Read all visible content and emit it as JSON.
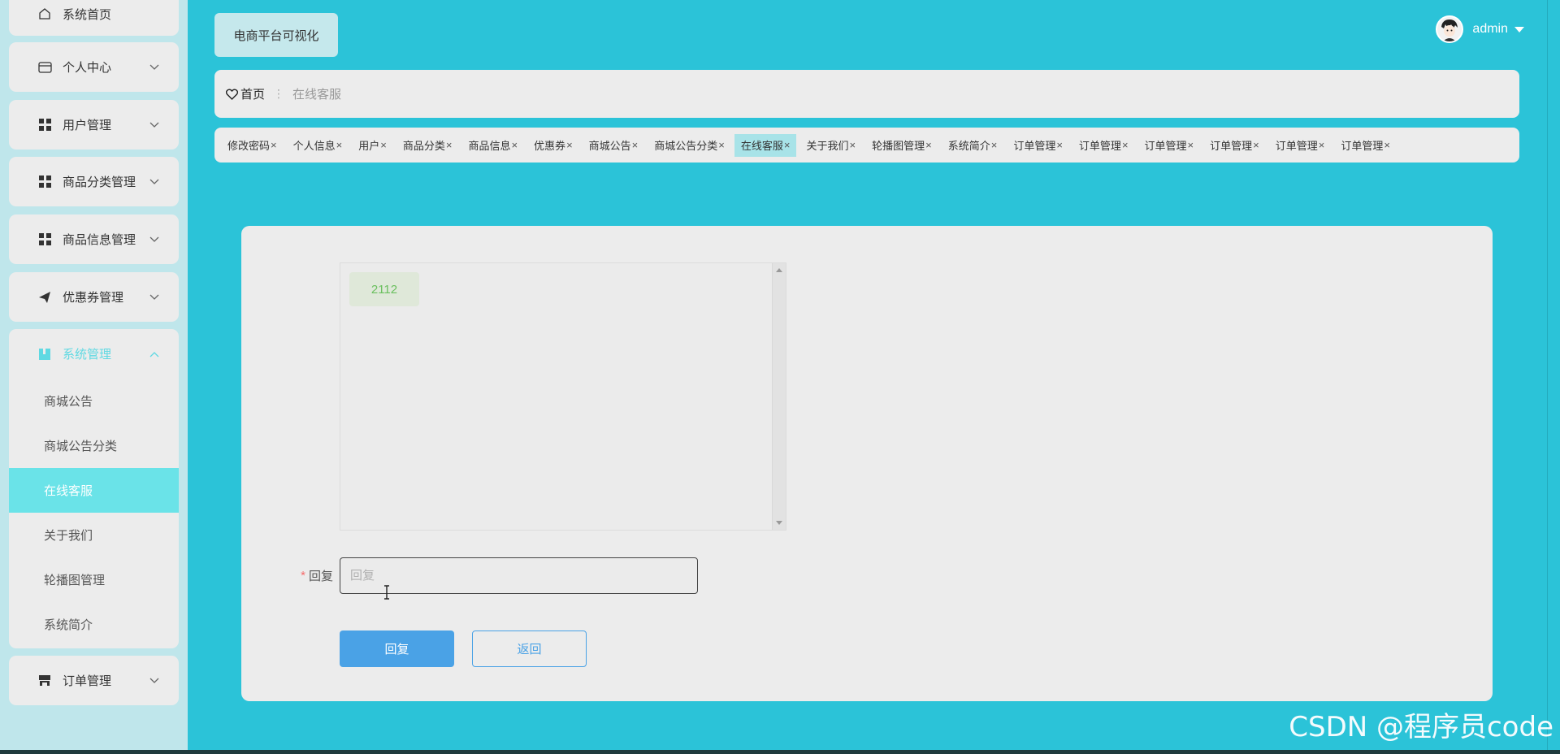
{
  "app": {
    "title": "电商平台可视化"
  },
  "user": {
    "name": "admin"
  },
  "sidebar": {
    "items": [
      {
        "label": "系统首页",
        "icon": "home-icon"
      },
      {
        "label": "个人中心",
        "icon": "card-icon"
      },
      {
        "label": "用户管理",
        "icon": "grid-icon"
      },
      {
        "label": "商品分类管理",
        "icon": "grid-icon"
      },
      {
        "label": "商品信息管理",
        "icon": "grid-icon"
      },
      {
        "label": "优惠券管理",
        "icon": "send-icon"
      },
      {
        "label": "系统管理",
        "icon": "book-icon"
      },
      {
        "label": "订单管理",
        "icon": "store-icon"
      }
    ],
    "system_sub": [
      "商城公告",
      "商城公告分类",
      "在线客服",
      "关于我们",
      "轮播图管理",
      "系统简介"
    ]
  },
  "breadcrumb": {
    "home": "首页",
    "current": "在线客服"
  },
  "tabs": [
    "修改密码",
    "个人信息",
    "用户",
    "商品分类",
    "商品信息",
    "优惠券",
    "商城公告",
    "商城公告分类",
    "在线客服",
    "关于我们",
    "轮播图管理",
    "系统简介",
    "订单管理",
    "订单管理",
    "订单管理",
    "订单管理",
    "订单管理",
    "订单管理"
  ],
  "chat": {
    "messages": [
      "2112"
    ]
  },
  "form": {
    "reply_label": "回复",
    "reply_placeholder": "回复",
    "submit": "回复",
    "back": "返回"
  },
  "watermark": "CSDN @程序员code",
  "colors": {
    "accent": "#2bc3d8",
    "primary_button": "#4aa2e6",
    "active_sub": "#6ae3e8"
  }
}
